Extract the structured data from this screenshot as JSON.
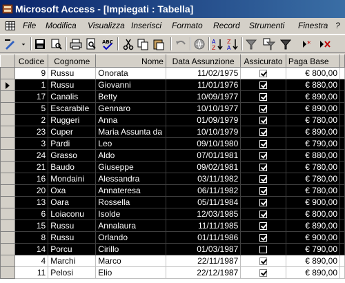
{
  "window": {
    "title": "Microsoft Access - [Impiegati : Tabella]"
  },
  "menu": [
    "File",
    "Modifica",
    "Visualizza",
    "Inserisci",
    "Formato",
    "Record",
    "Strumenti",
    "Finestra",
    "?"
  ],
  "toolbar": {
    "icons": [
      "design-view-icon",
      "dropdown-arrow-icon",
      "save-icon",
      "search-icon",
      "print-icon",
      "print-preview-icon",
      "spell-check-icon",
      "cut-icon",
      "copy-icon",
      "paste-icon",
      "undo-icon",
      "hyperlink-icon",
      "sort-ascending-icon",
      "sort-descending-icon",
      "filter-by-selection-icon",
      "filter-by-form-icon",
      "apply-filter-icon",
      "new-record-icon",
      "delete-record-icon"
    ]
  },
  "table": {
    "columns": [
      "Codice",
      "Cognome",
      "Nome",
      "Data Assunzione",
      "Assicurato",
      "Paga Base"
    ],
    "current_row_index": 1,
    "rows": [
      {
        "codice": "9",
        "cognome": "Russu",
        "nome": "Onorata",
        "data": "11/02/1975",
        "assicurato": true,
        "paga": "€ 800,00",
        "selected": false
      },
      {
        "codice": "1",
        "cognome": "Russu",
        "nome": "Giovanni",
        "data": "11/01/1976",
        "assicurato": true,
        "paga": "€ 880,00",
        "selected": true
      },
      {
        "codice": "17",
        "cognome": "Canalis",
        "nome": "Betty",
        "data": "10/09/1977",
        "assicurato": true,
        "paga": "€ 890,00",
        "selected": true
      },
      {
        "codice": "5",
        "cognome": "Escarabile",
        "nome": "Gennaro",
        "data": "10/10/1977",
        "assicurato": true,
        "paga": "€ 890,00",
        "selected": true
      },
      {
        "codice": "2",
        "cognome": "Ruggeri",
        "nome": "Anna",
        "data": "01/09/1979",
        "assicurato": true,
        "paga": "€ 780,00",
        "selected": true
      },
      {
        "codice": "23",
        "cognome": "Cuper",
        "nome": "Maria Assunta da",
        "data": "10/10/1979",
        "assicurato": true,
        "paga": "€ 890,00",
        "selected": true
      },
      {
        "codice": "3",
        "cognome": "Pardi",
        "nome": "Leo",
        "data": "09/10/1980",
        "assicurato": true,
        "paga": "€ 790,00",
        "selected": true
      },
      {
        "codice": "24",
        "cognome": "Grasso",
        "nome": "Aldo",
        "data": "07/01/1981",
        "assicurato": true,
        "paga": "€ 880,00",
        "selected": true
      },
      {
        "codice": "21",
        "cognome": "Baudo",
        "nome": "Giuseppe",
        "data": "09/02/1981",
        "assicurato": true,
        "paga": "€ 780,00",
        "selected": true
      },
      {
        "codice": "16",
        "cognome": "Mondaini",
        "nome": "Alessandra",
        "data": "03/11/1982",
        "assicurato": true,
        "paga": "€ 780,00",
        "selected": true
      },
      {
        "codice": "20",
        "cognome": "Oxa",
        "nome": "Annateresa",
        "data": "06/11/1982",
        "assicurato": true,
        "paga": "€ 780,00",
        "selected": true
      },
      {
        "codice": "13",
        "cognome": "Oara",
        "nome": "Rossella",
        "data": "05/11/1984",
        "assicurato": true,
        "paga": "€ 900,00",
        "selected": true
      },
      {
        "codice": "6",
        "cognome": "Loiaconu",
        "nome": "Isolde",
        "data": "12/03/1985",
        "assicurato": true,
        "paga": "€ 800,00",
        "selected": true
      },
      {
        "codice": "15",
        "cognome": "Russu",
        "nome": "Annalaura",
        "data": "11/11/1985",
        "assicurato": true,
        "paga": "€ 890,00",
        "selected": true
      },
      {
        "codice": "8",
        "cognome": "Russu",
        "nome": "Orlando",
        "data": "01/11/1986",
        "assicurato": true,
        "paga": "€ 900,00",
        "selected": true
      },
      {
        "codice": "14",
        "cognome": "Porcu",
        "nome": "Cirillo",
        "data": "01/03/1987",
        "assicurato": false,
        "paga": "€ 790,00",
        "selected": true
      },
      {
        "codice": "4",
        "cognome": "Marchi",
        "nome": "Marco",
        "data": "22/11/1987",
        "assicurato": true,
        "paga": "€ 890,00",
        "selected": false
      },
      {
        "codice": "11",
        "cognome": "Pelosi",
        "nome": "Elio",
        "data": "22/12/1987",
        "assicurato": true,
        "paga": "€ 890,00",
        "selected": false
      }
    ]
  }
}
